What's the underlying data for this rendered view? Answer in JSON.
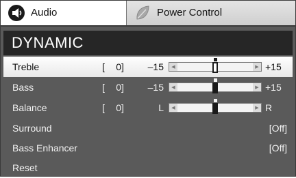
{
  "tabs": [
    {
      "label": "Audio",
      "icon": "speaker-icon",
      "selected": true
    },
    {
      "label": "Power Control",
      "icon": "leaf-icon",
      "selected": false
    }
  ],
  "section": {
    "title": "DYNAMIC"
  },
  "rows": {
    "treble": {
      "label": "Treble",
      "bracket_open": "[",
      "value": "0",
      "bracket_close": "]",
      "min": "–15",
      "max": "+15",
      "level": 0.5
    },
    "bass": {
      "label": "Bass",
      "bracket_open": "[",
      "value": "0",
      "bracket_close": "]",
      "min": "–15",
      "max": "+15",
      "level": 0.5
    },
    "balance": {
      "label": "Balance",
      "bracket_open": "[",
      "value": "0",
      "bracket_close": "]",
      "min": "L",
      "max": "R",
      "level": 0.5
    },
    "surround": {
      "label": "Surround",
      "status": "[Off]"
    },
    "bass_enhancer": {
      "label": "Bass Enhancer",
      "status": "[Off]"
    },
    "reset": {
      "label": "Reset"
    }
  },
  "colors": {
    "panel": "#5a5a5a",
    "header": "#262626",
    "selected_row": "#ffffff"
  }
}
